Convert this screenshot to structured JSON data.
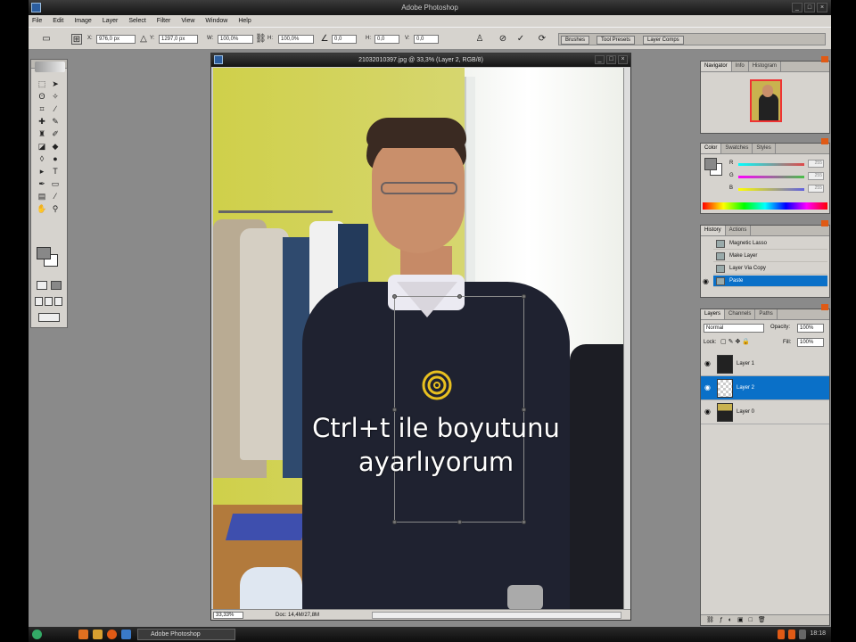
{
  "app": {
    "title": "Adobe Photoshop"
  },
  "menu": [
    "File",
    "Edit",
    "Image",
    "Layer",
    "Select",
    "Filter",
    "View",
    "Window",
    "Help"
  ],
  "options": {
    "x_label": "X:",
    "x_value": "976,0 px",
    "y_label": "Y:",
    "y_value": "1297,0 px",
    "w_label": "W:",
    "w_value": "100,0%",
    "h_label": "H:",
    "h_value": "100,0%",
    "angle_value": "0,0",
    "hskew_label": "H:",
    "hskew_value": "0,0",
    "vskew_label": "V:",
    "vskew_value": "0,0",
    "cancel_symbol": "⊘",
    "commit_symbol": "✓",
    "wells": [
      "Brushes",
      "Tool Presets",
      "Layer Comps"
    ]
  },
  "document": {
    "title": "21032010397.jpg @ 33,3% (Layer 2, RGB/8)",
    "zoom": "33,33%",
    "doc_info": "Doc: 14,4M/27,8M",
    "caption_line1": "Ctrl+t ile boyutunu",
    "caption_line2": "ayarlıyorum"
  },
  "navigator": {
    "tabs": [
      "Navigator",
      "Info",
      "Histogram"
    ]
  },
  "color": {
    "tabs": [
      "Color",
      "Swatches",
      "Styles"
    ],
    "channels": [
      {
        "label": "R",
        "value": "255",
        "track": "#e04848"
      },
      {
        "label": "G",
        "value": "255",
        "track": "#48c048"
      },
      {
        "label": "B",
        "value": "255",
        "track": "#6060e0"
      }
    ]
  },
  "history": {
    "tabs": [
      "History",
      "Actions"
    ],
    "items": [
      "Magnetic Lasso",
      "Make Layer",
      "Layer Via Copy",
      "Paste"
    ],
    "selected_index": 3
  },
  "layers": {
    "tabs": [
      "Layers",
      "Channels",
      "Paths"
    ],
    "blend_mode": "Normal",
    "opacity_label": "Opacity:",
    "opacity": "100%",
    "lock_label": "Lock:",
    "fill_label": "Fill:",
    "fill": "100%",
    "rows": [
      "Layer 1",
      "Layer 2",
      "Layer 0"
    ],
    "selected_index": 1
  },
  "taskbar": {
    "task": "Adobe Photoshop",
    "clock": "18:18"
  },
  "colors": {
    "selection": "#0a70c8",
    "target": "#e8c020"
  }
}
